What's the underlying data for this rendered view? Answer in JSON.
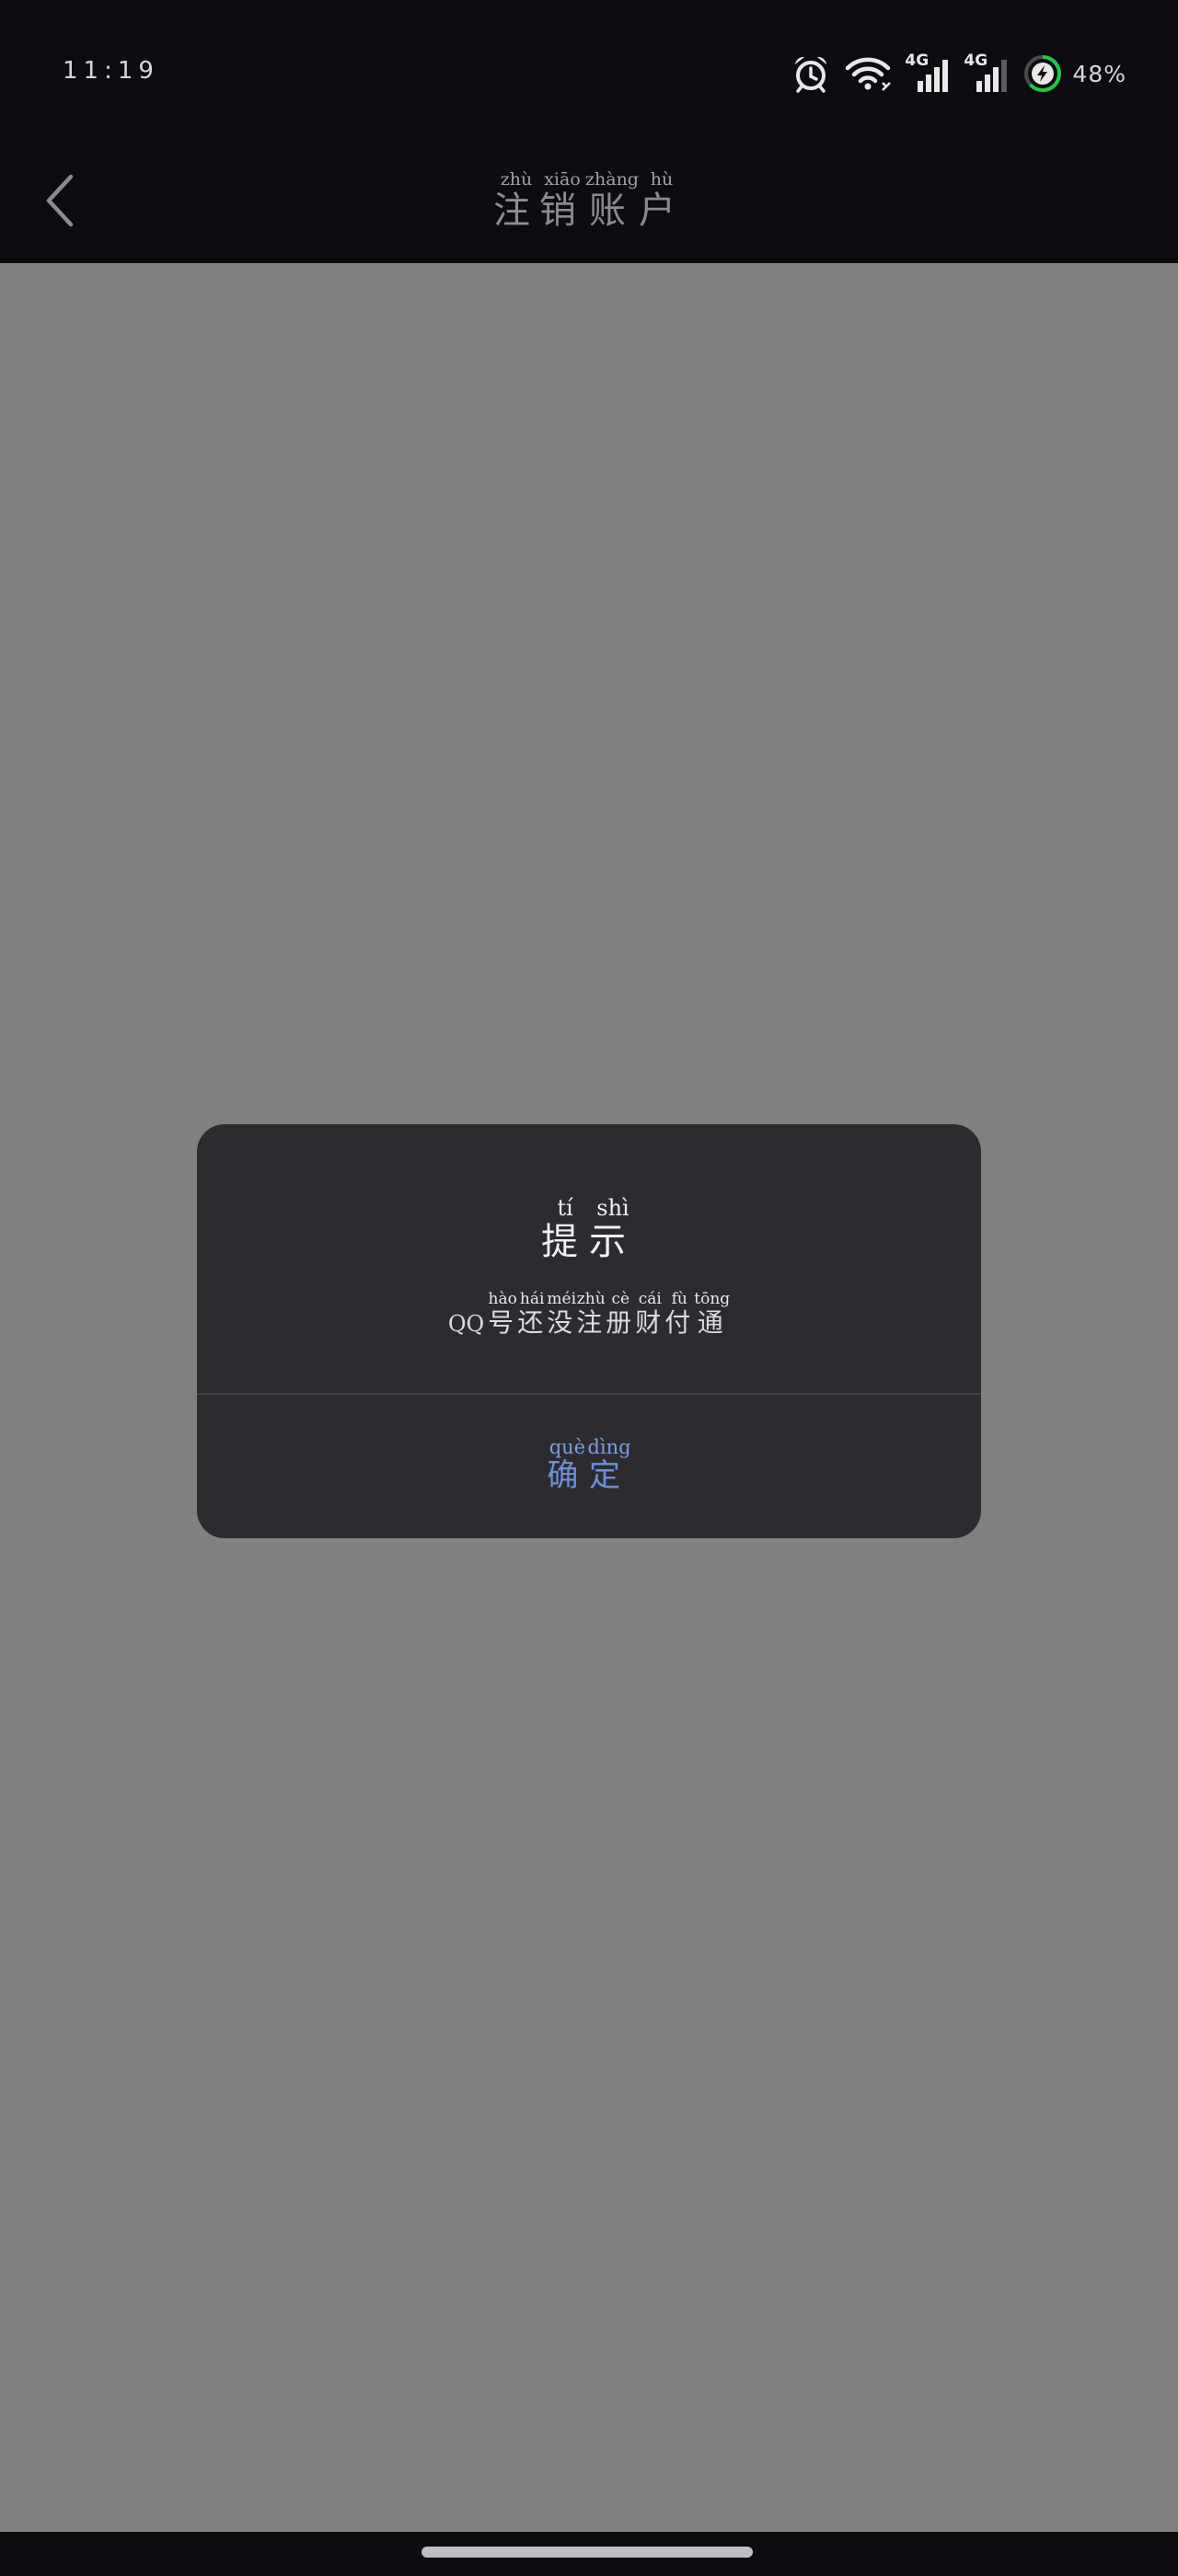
{
  "status_bar": {
    "time": "11:19",
    "network_label_1": "4G",
    "network_label_2": "4G",
    "battery_percent": "48%",
    "icons": [
      "alarm-icon",
      "wifi-icon",
      "signal-icon",
      "signal-icon",
      "battery-charging-icon"
    ],
    "battery_color": "#27c24c"
  },
  "nav": {
    "back_icon": "chevron-left-icon",
    "title": [
      {
        "char": "注",
        "pinyin": "zhù"
      },
      {
        "char": "销",
        "pinyin": "xiāo"
      },
      {
        "char": "账",
        "pinyin": "zhàng"
      },
      {
        "char": "户",
        "pinyin": "hù"
      }
    ]
  },
  "dialog": {
    "title": [
      {
        "char": "提",
        "pinyin": "tí"
      },
      {
        "char": "示",
        "pinyin": "shì"
      }
    ],
    "message_prefix": "QQ",
    "message": [
      {
        "char": "号",
        "pinyin": "hào"
      },
      {
        "char": "还",
        "pinyin": "hái"
      },
      {
        "char": "没",
        "pinyin": "méi"
      },
      {
        "char": "注",
        "pinyin": "zhù"
      },
      {
        "char": "册",
        "pinyin": "cè"
      },
      {
        "char": "财",
        "pinyin": "cái"
      },
      {
        "char": "付",
        "pinyin": "fù"
      },
      {
        "char": "通",
        "pinyin": "tōng"
      }
    ],
    "confirm": [
      {
        "char": "确",
        "pinyin": "què"
      },
      {
        "char": "定",
        "pinyin": "dìng"
      }
    ],
    "confirm_color": "#6f8fd6"
  },
  "colors": {
    "background": "#0c0d10",
    "overlay": "#808080",
    "dialog": "#2c2c30"
  }
}
